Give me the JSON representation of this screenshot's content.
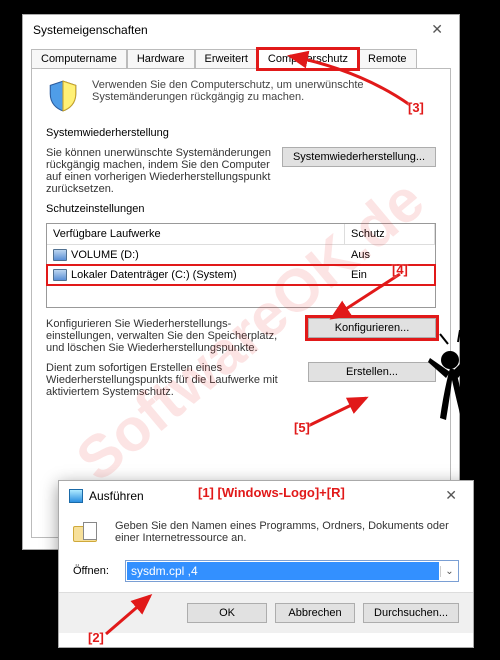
{
  "sysprops": {
    "title": "Systemeigenschaften",
    "tabs": [
      "Computername",
      "Hardware",
      "Erweitert",
      "Computerschutz",
      "Remote"
    ],
    "active_tab_index": 3,
    "intro": "Verwenden Sie den Computerschutz, um unerwünschte Systemänderungen rückgängig zu machen.",
    "group_restore": {
      "label": "Systemwiederherstellung",
      "text": "Sie können unerwünschte Systemänderungen rückgängig machen, indem Sie den Computer auf einen vorherigen Wiederherstellungspunkt zurücksetzen.",
      "button": "Systemwiederherstellung..."
    },
    "group_settings": {
      "label": "Schutzeinstellungen",
      "table": {
        "headers": [
          "Verfügbare Laufwerke",
          "Schutz"
        ],
        "rows": [
          {
            "icon": "drive-icon",
            "name": "VOLUME (D:)",
            "status": "Aus"
          },
          {
            "icon": "drive-icon",
            "name": "Lokaler Datenträger (C:) (System)",
            "status": "Ein"
          }
        ],
        "highlight_row_index": 1
      },
      "config_text": "Konfigurieren Sie Wiederherstellungs-einstellungen, verwalten Sie den Speicherplatz, und löschen Sie Wiederherstellungspunkte.",
      "config_button": "Konfigurieren...",
      "create_text": "Dient zum sofortigen Erstellen eines Wiederherstellungspunkts für die Laufwerke mit aktiviertem Systemschutz.",
      "create_button": "Erstellen..."
    }
  },
  "rundlg": {
    "title": "Ausführen",
    "desc": "Geben Sie den Namen eines Programms, Ordners, Dokuments oder einer Internetressource an.",
    "open_label": "Öffnen:",
    "open_value": "sysdm.cpl ,4",
    "buttons": {
      "ok": "OK",
      "cancel": "Abbrechen",
      "browse": "Durchsuchen..."
    }
  },
  "annotations": {
    "a1": "[1] [Windows-Logo]+[R]",
    "a2": "[2]",
    "a3": "[3]",
    "a4": "[4]",
    "a5": "[5]"
  },
  "watermark": "SoftwareOK.de"
}
